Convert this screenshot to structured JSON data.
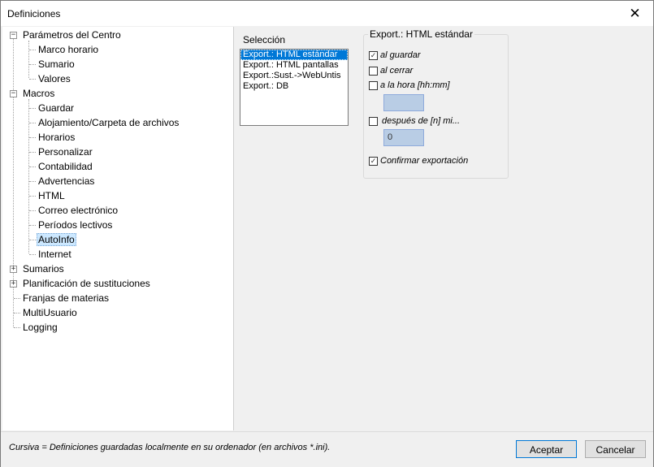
{
  "window": {
    "title": "Definiciones",
    "close_glyph": "✕"
  },
  "tree": {
    "expanders": {
      "collapse": "−",
      "expand": "+"
    },
    "items": [
      {
        "label": "Parámetros del Centro"
      },
      {
        "label": "Marco horario"
      },
      {
        "label": "Sumario"
      },
      {
        "label": "Valores"
      },
      {
        "label": "Macros"
      },
      {
        "label": "Guardar"
      },
      {
        "label": "Alojamiento/Carpeta de archivos"
      },
      {
        "label": "Horarios"
      },
      {
        "label": "Personalizar"
      },
      {
        "label": "Contabilidad"
      },
      {
        "label": "Advertencias"
      },
      {
        "label": "HTML"
      },
      {
        "label": "Correo electrónico"
      },
      {
        "label": "Períodos lectivos"
      },
      {
        "label": "AutoInfo",
        "selected": true
      },
      {
        "label": "Internet"
      },
      {
        "label": "Sumarios"
      },
      {
        "label": "Planificación de sustituciones"
      },
      {
        "label": "Franjas de materias"
      },
      {
        "label": "MultiUsuario"
      },
      {
        "label": "Logging"
      }
    ]
  },
  "selection": {
    "label": "Selección",
    "items": [
      "Export.: HTML estándar",
      "Export.: HTML pantallas",
      "Export.:Sust.->WebUntis",
      "Export.: DB"
    ],
    "selected_index": 0
  },
  "group": {
    "title": "Export.: HTML estándar",
    "check_glyph": "✓",
    "options": [
      {
        "label": "al guardar",
        "checked": true
      },
      {
        "label": "al cerrar",
        "checked": false
      },
      {
        "label": "a la hora [hh:mm]",
        "checked": false
      },
      {
        "label": "después de [n] mi...",
        "checked": false
      },
      {
        "label": "Confirmar exportación",
        "checked": true
      }
    ],
    "time_value": "",
    "minutes_value": "0"
  },
  "footer": {
    "hint": "Cursiva = Definiciones guardadas localmente en su ordenador (en archivos *.ini).",
    "accept_label": "Aceptar",
    "cancel_label": "Cancelar"
  }
}
